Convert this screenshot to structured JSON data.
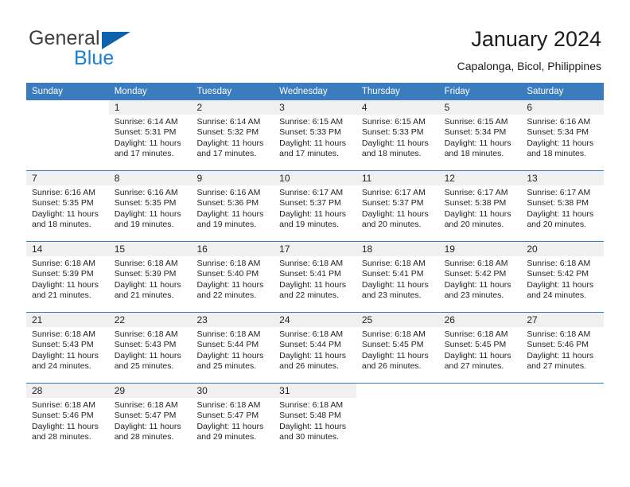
{
  "brand": {
    "name_top": "General",
    "name_bottom": "Blue",
    "accent_color": "#0d62ac",
    "blue_text_color": "#1b80d4"
  },
  "header": {
    "title": "January 2024",
    "subtitle": "Capalonga, Bicol, Philippines"
  },
  "theme": {
    "header_blue": "#3a7cbe",
    "date_band_gray": "#f0f0f0",
    "text_color": "#231f20"
  },
  "weekdays": [
    "Sunday",
    "Monday",
    "Tuesday",
    "Wednesday",
    "Thursday",
    "Friday",
    "Saturday"
  ],
  "weeks": [
    [
      {
        "date": "",
        "sunrise": "",
        "sunset": "",
        "daylight": "",
        "empty": true
      },
      {
        "date": "1",
        "sunrise": "Sunrise: 6:14 AM",
        "sunset": "Sunset: 5:31 PM",
        "daylight": "Daylight: 11 hours and 17 minutes."
      },
      {
        "date": "2",
        "sunrise": "Sunrise: 6:14 AM",
        "sunset": "Sunset: 5:32 PM",
        "daylight": "Daylight: 11 hours and 17 minutes."
      },
      {
        "date": "3",
        "sunrise": "Sunrise: 6:15 AM",
        "sunset": "Sunset: 5:33 PM",
        "daylight": "Daylight: 11 hours and 17 minutes."
      },
      {
        "date": "4",
        "sunrise": "Sunrise: 6:15 AM",
        "sunset": "Sunset: 5:33 PM",
        "daylight": "Daylight: 11 hours and 18 minutes."
      },
      {
        "date": "5",
        "sunrise": "Sunrise: 6:15 AM",
        "sunset": "Sunset: 5:34 PM",
        "daylight": "Daylight: 11 hours and 18 minutes."
      },
      {
        "date": "6",
        "sunrise": "Sunrise: 6:16 AM",
        "sunset": "Sunset: 5:34 PM",
        "daylight": "Daylight: 11 hours and 18 minutes."
      }
    ],
    [
      {
        "date": "7",
        "sunrise": "Sunrise: 6:16 AM",
        "sunset": "Sunset: 5:35 PM",
        "daylight": "Daylight: 11 hours and 18 minutes."
      },
      {
        "date": "8",
        "sunrise": "Sunrise: 6:16 AM",
        "sunset": "Sunset: 5:35 PM",
        "daylight": "Daylight: 11 hours and 19 minutes."
      },
      {
        "date": "9",
        "sunrise": "Sunrise: 6:16 AM",
        "sunset": "Sunset: 5:36 PM",
        "daylight": "Daylight: 11 hours and 19 minutes."
      },
      {
        "date": "10",
        "sunrise": "Sunrise: 6:17 AM",
        "sunset": "Sunset: 5:37 PM",
        "daylight": "Daylight: 11 hours and 19 minutes."
      },
      {
        "date": "11",
        "sunrise": "Sunrise: 6:17 AM",
        "sunset": "Sunset: 5:37 PM",
        "daylight": "Daylight: 11 hours and 20 minutes."
      },
      {
        "date": "12",
        "sunrise": "Sunrise: 6:17 AM",
        "sunset": "Sunset: 5:38 PM",
        "daylight": "Daylight: 11 hours and 20 minutes."
      },
      {
        "date": "13",
        "sunrise": "Sunrise: 6:17 AM",
        "sunset": "Sunset: 5:38 PM",
        "daylight": "Daylight: 11 hours and 20 minutes."
      }
    ],
    [
      {
        "date": "14",
        "sunrise": "Sunrise: 6:18 AM",
        "sunset": "Sunset: 5:39 PM",
        "daylight": "Daylight: 11 hours and 21 minutes."
      },
      {
        "date": "15",
        "sunrise": "Sunrise: 6:18 AM",
        "sunset": "Sunset: 5:39 PM",
        "daylight": "Daylight: 11 hours and 21 minutes."
      },
      {
        "date": "16",
        "sunrise": "Sunrise: 6:18 AM",
        "sunset": "Sunset: 5:40 PM",
        "daylight": "Daylight: 11 hours and 22 minutes."
      },
      {
        "date": "17",
        "sunrise": "Sunrise: 6:18 AM",
        "sunset": "Sunset: 5:41 PM",
        "daylight": "Daylight: 11 hours and 22 minutes."
      },
      {
        "date": "18",
        "sunrise": "Sunrise: 6:18 AM",
        "sunset": "Sunset: 5:41 PM",
        "daylight": "Daylight: 11 hours and 23 minutes."
      },
      {
        "date": "19",
        "sunrise": "Sunrise: 6:18 AM",
        "sunset": "Sunset: 5:42 PM",
        "daylight": "Daylight: 11 hours and 23 minutes."
      },
      {
        "date": "20",
        "sunrise": "Sunrise: 6:18 AM",
        "sunset": "Sunset: 5:42 PM",
        "daylight": "Daylight: 11 hours and 24 minutes."
      }
    ],
    [
      {
        "date": "21",
        "sunrise": "Sunrise: 6:18 AM",
        "sunset": "Sunset: 5:43 PM",
        "daylight": "Daylight: 11 hours and 24 minutes."
      },
      {
        "date": "22",
        "sunrise": "Sunrise: 6:18 AM",
        "sunset": "Sunset: 5:43 PM",
        "daylight": "Daylight: 11 hours and 25 minutes."
      },
      {
        "date": "23",
        "sunrise": "Sunrise: 6:18 AM",
        "sunset": "Sunset: 5:44 PM",
        "daylight": "Daylight: 11 hours and 25 minutes."
      },
      {
        "date": "24",
        "sunrise": "Sunrise: 6:18 AM",
        "sunset": "Sunset: 5:44 PM",
        "daylight": "Daylight: 11 hours and 26 minutes."
      },
      {
        "date": "25",
        "sunrise": "Sunrise: 6:18 AM",
        "sunset": "Sunset: 5:45 PM",
        "daylight": "Daylight: 11 hours and 26 minutes."
      },
      {
        "date": "26",
        "sunrise": "Sunrise: 6:18 AM",
        "sunset": "Sunset: 5:45 PM",
        "daylight": "Daylight: 11 hours and 27 minutes."
      },
      {
        "date": "27",
        "sunrise": "Sunrise: 6:18 AM",
        "sunset": "Sunset: 5:46 PM",
        "daylight": "Daylight: 11 hours and 27 minutes."
      }
    ],
    [
      {
        "date": "28",
        "sunrise": "Sunrise: 6:18 AM",
        "sunset": "Sunset: 5:46 PM",
        "daylight": "Daylight: 11 hours and 28 minutes."
      },
      {
        "date": "29",
        "sunrise": "Sunrise: 6:18 AM",
        "sunset": "Sunset: 5:47 PM",
        "daylight": "Daylight: 11 hours and 28 minutes."
      },
      {
        "date": "30",
        "sunrise": "Sunrise: 6:18 AM",
        "sunset": "Sunset: 5:47 PM",
        "daylight": "Daylight: 11 hours and 29 minutes."
      },
      {
        "date": "31",
        "sunrise": "Sunrise: 6:18 AM",
        "sunset": "Sunset: 5:48 PM",
        "daylight": "Daylight: 11 hours and 30 minutes."
      },
      {
        "date": "",
        "sunrise": "",
        "sunset": "",
        "daylight": "",
        "empty": true
      },
      {
        "date": "",
        "sunrise": "",
        "sunset": "",
        "daylight": "",
        "empty": true
      },
      {
        "date": "",
        "sunrise": "",
        "sunset": "",
        "daylight": "",
        "empty": true
      }
    ]
  ]
}
